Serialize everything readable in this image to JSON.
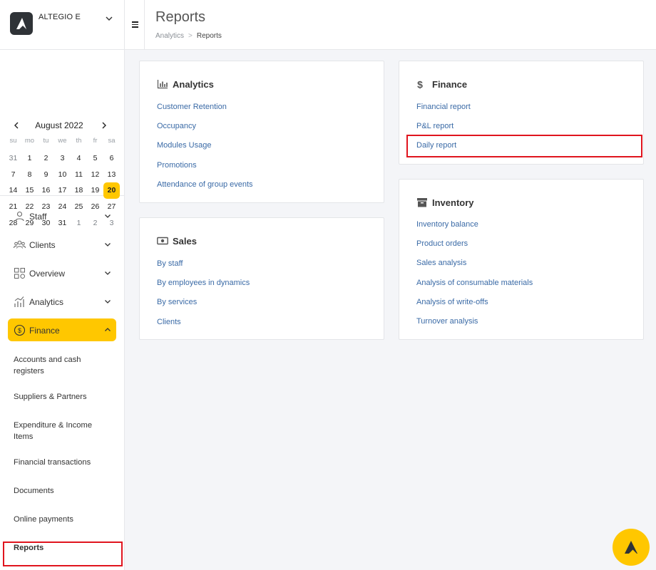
{
  "company": {
    "name": "ALTEGIO E",
    "logo_icon": "altegio-logo"
  },
  "calendar": {
    "month": "August 2022",
    "weekdays": [
      "su",
      "mo",
      "tu",
      "we",
      "th",
      "fr",
      "sa"
    ],
    "weeks": [
      [
        "31",
        "1",
        "2",
        "3",
        "4",
        "5",
        "6"
      ],
      [
        "7",
        "8",
        "9",
        "10",
        "11",
        "12",
        "13"
      ],
      [
        "14",
        "15",
        "16",
        "17",
        "18",
        "19",
        "20"
      ],
      [
        "21",
        "22",
        "23",
        "24",
        "25",
        "26",
        "27"
      ],
      [
        "28",
        "29",
        "30",
        "31",
        "1",
        "2",
        "3"
      ]
    ],
    "selected": "20"
  },
  "nav": {
    "staff": "Staff",
    "clients": "Clients",
    "overview": "Overview",
    "analytics": "Analytics",
    "finance": "Finance",
    "finance_items": [
      "Accounts and cash registers",
      "Suppliers & Partners",
      "Expenditure & Income Items",
      "Financial transactions",
      "Documents",
      "Online payments",
      "Reports"
    ]
  },
  "header": {
    "title": "Reports",
    "breadcrumb": {
      "parent": "Analytics",
      "separator": ">",
      "current": "Reports"
    }
  },
  "cards": {
    "analytics": {
      "title": "Analytics",
      "links": [
        "Customer Retention",
        "Occupancy",
        "Modules Usage",
        "Promotions",
        "Attendance of group events"
      ]
    },
    "sales": {
      "title": "Sales",
      "links": [
        "By staff",
        "By employees in dynamics",
        "By services",
        "Clients"
      ]
    },
    "finance": {
      "title": "Finance",
      "links": [
        "Financial report",
        "P&L report",
        "Daily report"
      ]
    },
    "inventory": {
      "title": "Inventory",
      "links": [
        "Inventory balance",
        "Product orders",
        "Sales analysis",
        "Analysis of consumable materials",
        "Analysis of write-offs",
        "Turnover analysis"
      ]
    }
  },
  "colors": {
    "accent": "#ffc700",
    "link": "#3a6aa6",
    "highlight": "#e0141e"
  }
}
